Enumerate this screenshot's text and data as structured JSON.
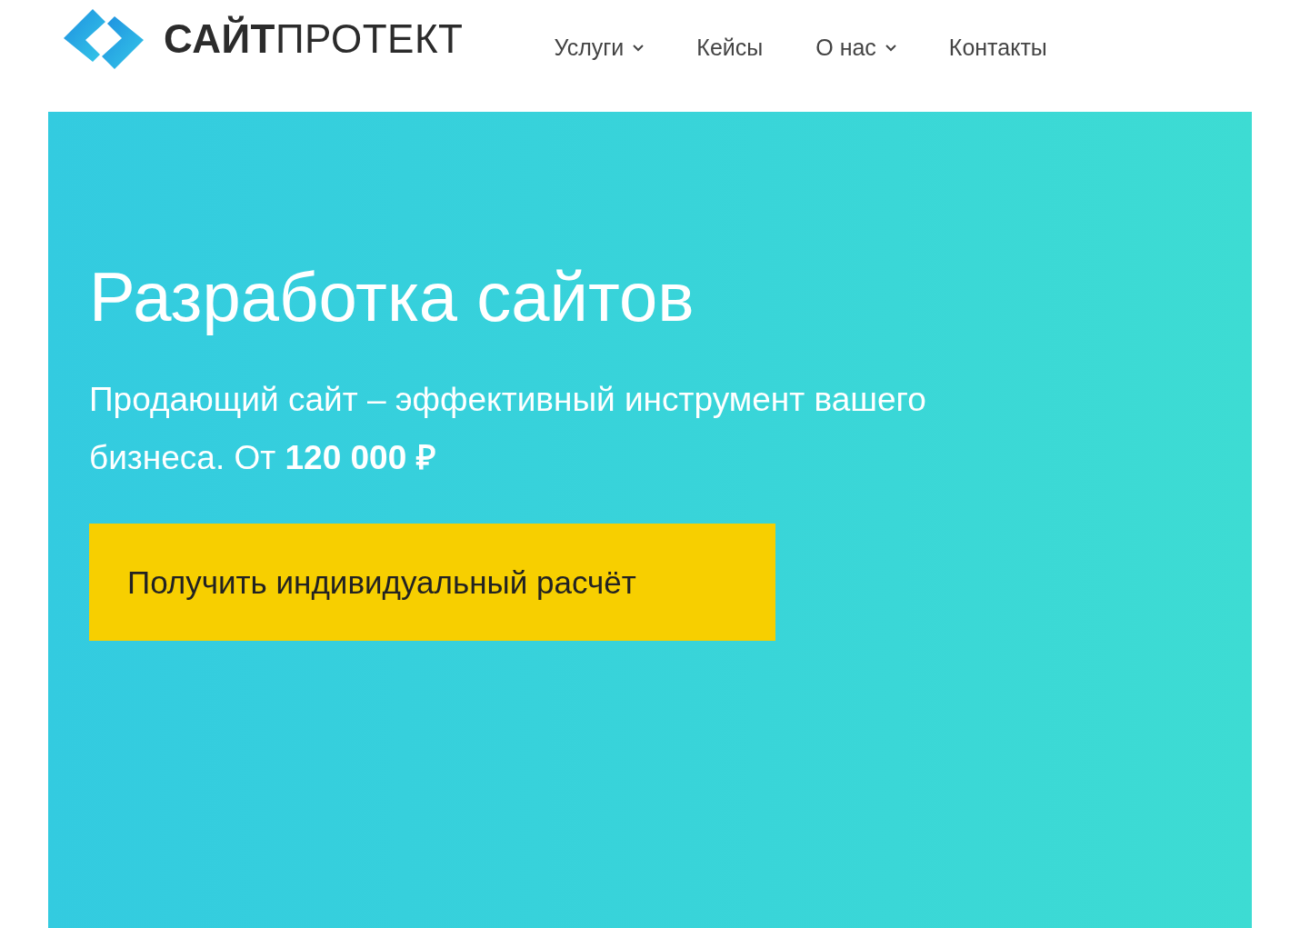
{
  "header": {
    "logo": "**САЙТ**ПРОТЕКТ",
    "nav": [
      {
        "label": "Услуги",
        "has_dropdown": true
      },
      {
        "label": "Кейсы",
        "has_dropdown": false
      },
      {
        "label": "О нас",
        "has_dropdown": true
      },
      {
        "label": "Контакты",
        "has_dropdown": false
      }
    ]
  },
  "hero": {
    "title": "Разработка сайтов",
    "subtitle": "Продающий сайт – эффективный инструмент вашего бизнеса. От **120 000 ₽**",
    "button": "Получить индивидуальный расчёт"
  }
}
